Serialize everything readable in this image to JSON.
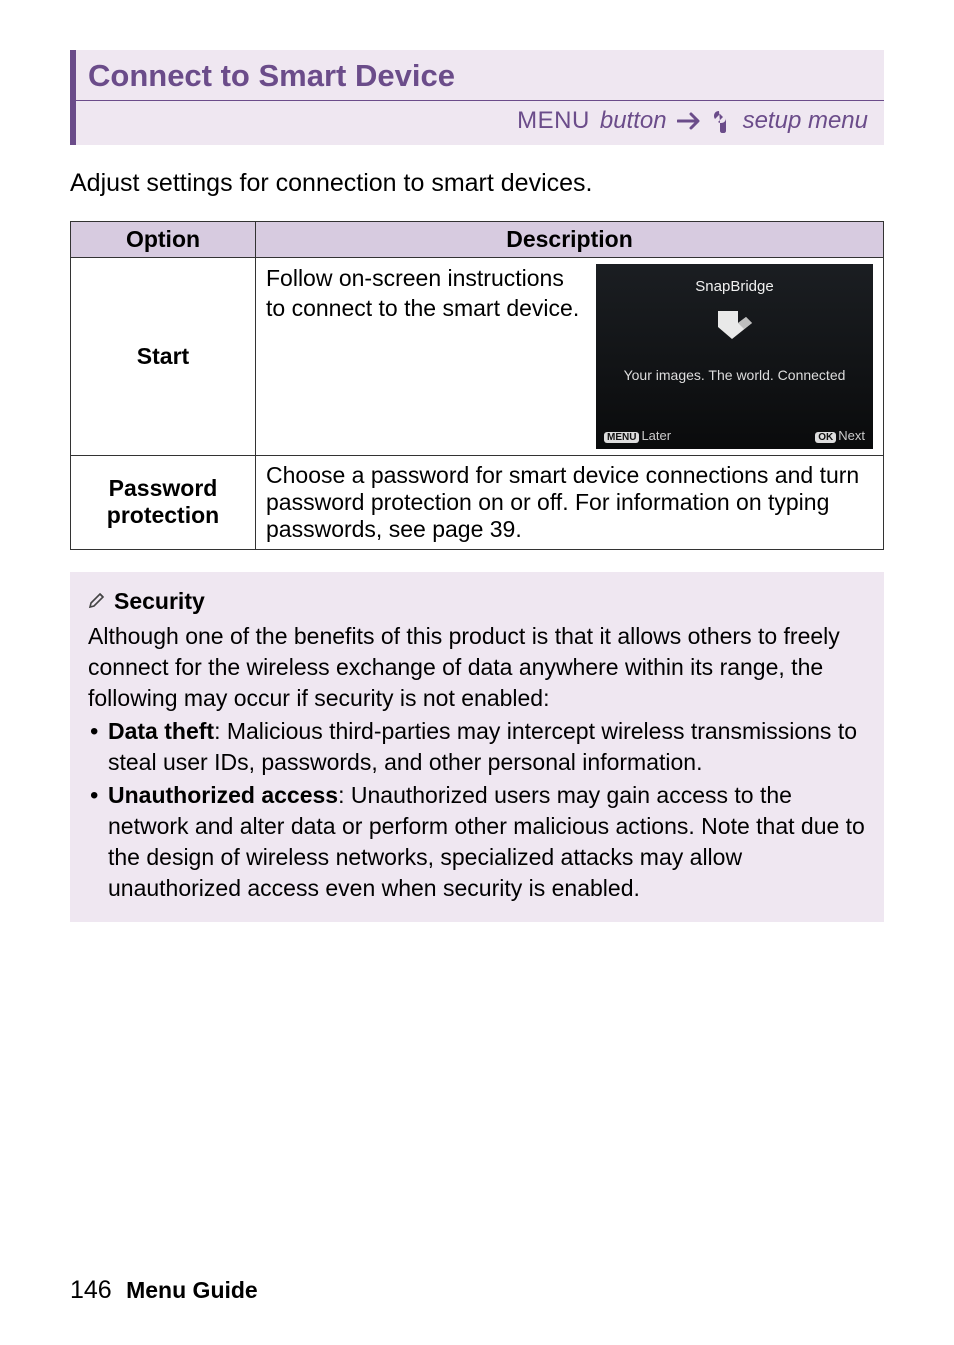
{
  "header": {
    "title": "Connect to Smart Device",
    "menu_label": "MENU",
    "button_word": "button",
    "setup_menu": "setup menu"
  },
  "intro": "Adjust settings for connection to smart devices.",
  "table": {
    "col_option": "Option",
    "col_description": "Description",
    "row_start": {
      "label": "Start",
      "text": "Follow on-screen instructions to connect to the smart device."
    },
    "row_password": {
      "label_line1": "Password",
      "label_line2": "protection",
      "text": "Choose a password for smart device connections and turn password protection on or off.  For information on typing passwords, see page 39."
    }
  },
  "device": {
    "title": "SnapBridge",
    "caption": "Your images. The world. Connected",
    "later_pill": "MENU",
    "later_text": "Later",
    "next_pill": "OK",
    "next_text": "Next"
  },
  "note": {
    "heading": "Security",
    "para": "Although one of the benefits of this product is that it allows others to freely connect for the wireless exchange of data anywhere within its range, the following may occur if security is not enabled:",
    "b1_label": "Data theft",
    "b1_text": ": Malicious third-parties may intercept wireless transmissions to steal user IDs, passwords, and other personal information.",
    "b2_label": "Unauthorized access",
    "b2_text": ": Unauthorized users may gain access to the network and alter data or perform other malicious actions.  Note that due to the design of wireless networks, specialized attacks may allow unauthorized access even when security is enabled."
  },
  "footer": {
    "page": "146",
    "doc": "Menu Guide"
  }
}
